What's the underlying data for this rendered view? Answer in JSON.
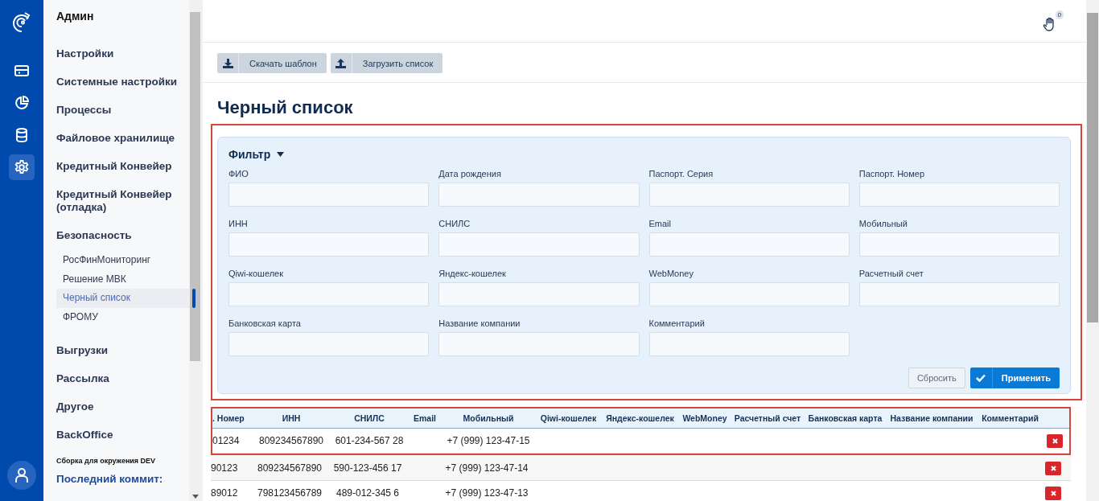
{
  "rail": {
    "items": [
      {
        "kind": "card",
        "selected": false
      },
      {
        "kind": "chart",
        "selected": false
      },
      {
        "kind": "database",
        "selected": false
      },
      {
        "kind": "settings",
        "selected": true
      }
    ]
  },
  "sidebar": {
    "title": "Админ",
    "items": [
      {
        "label": "Настройки",
        "selected": false
      },
      {
        "label": "Системные настройки",
        "selected": false
      },
      {
        "label": "Процессы",
        "selected": false
      },
      {
        "label": "Файловое хранилище",
        "selected": false
      },
      {
        "label": "Кредитный Конвейер",
        "selected": false
      },
      {
        "label": "Кредитный Конвейер (отладка)",
        "selected": false
      },
      {
        "label": "Безопасность",
        "selected": false,
        "children": [
          {
            "label": "РосФинМониторинг",
            "selected": false
          },
          {
            "label": "Решение МВК",
            "selected": false
          },
          {
            "label": "Черный список",
            "selected": true
          },
          {
            "label": "ФРОМУ",
            "selected": false
          }
        ]
      },
      {
        "label": "Выгрузки",
        "selected": false
      },
      {
        "label": "Рассылка",
        "selected": false
      },
      {
        "label": "Другое",
        "selected": false
      },
      {
        "label": "BackOffice",
        "selected": false
      }
    ],
    "build_note": "Сборка для окружения DEV",
    "commit_label": "Последний коммит:"
  },
  "topbar": {
    "badge": "0"
  },
  "toolbar": {
    "buttons": [
      {
        "kind": "download",
        "label": "Скачать шаблон"
      },
      {
        "kind": "upload",
        "label": "Загрузить список"
      }
    ]
  },
  "page_title": "Черный список",
  "filter": {
    "title": "Фильтр",
    "expanded": true,
    "highlighted": true,
    "fields": [
      {
        "label": "ФИО"
      },
      {
        "label": "Дата рождения"
      },
      {
        "label": "Паспорт. Серия"
      },
      {
        "label": "Паспорт. Номер"
      },
      {
        "label": "ИНН"
      },
      {
        "label": "СНИЛС"
      },
      {
        "label": "Email"
      },
      {
        "label": "Мобильный"
      },
      {
        "label": "Qiwi-кошелек"
      },
      {
        "label": "Яндекс-кошелек"
      },
      {
        "label": "WebMoney"
      },
      {
        "label": "Расчетный счет"
      },
      {
        "label": "Банковская карта"
      },
      {
        "label": "Название компании"
      },
      {
        "label": "Комментарий"
      }
    ],
    "reset": "Сбросить",
    "apply": "Применить"
  },
  "table": {
    "header_highlighted": true,
    "columns": [
      ". Номер",
      "ИНН",
      "СНИЛС",
      "Email",
      "Мобильный",
      "Qiwi-кошелек",
      "Яндекс-кошелек",
      "WebMoney",
      "Расчетный счет",
      "Банковская карта",
      "Название компании",
      "Комментарий"
    ],
    "rows": [
      {
        "highlighted": true,
        "cells": [
          "01234",
          "809234567890",
          "601-234-567 28",
          "",
          "+7 (999) 123-47-15",
          "",
          "",
          "",
          "",
          "",
          "",
          ""
        ]
      },
      {
        "highlighted": false,
        "cells": [
          "90123",
          "809234567890",
          "590-123-456 17",
          "",
          "+7 (999) 123-47-14",
          "",
          "",
          "",
          "",
          "",
          "",
          ""
        ]
      },
      {
        "highlighted": false,
        "cells": [
          "89012",
          "798123456789",
          "489-012-345 6",
          "",
          "+7 (999) 123-47-13",
          "",
          "",
          "",
          "",
          "",
          "",
          ""
        ]
      }
    ]
  }
}
